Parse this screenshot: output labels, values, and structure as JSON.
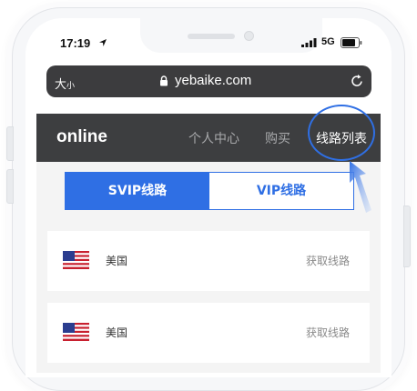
{
  "status_bar": {
    "time": "17:19",
    "network": "5G"
  },
  "browser": {
    "text_size_label": "大",
    "text_size_small": "小",
    "url": "yebaike.com"
  },
  "nav": {
    "logo": "online",
    "items": [
      {
        "label": "个人中心"
      },
      {
        "label": "购买"
      },
      {
        "label": "线路列表"
      }
    ]
  },
  "tabs": [
    {
      "label": "SVIP线路",
      "active": true
    },
    {
      "label": "VIP线路",
      "active": false
    }
  ],
  "routes": [
    {
      "country": "美国",
      "action": "获取线路"
    },
    {
      "country": "美国",
      "action": "获取线路"
    }
  ],
  "colors": {
    "accent": "#2f6fe4",
    "nav_bg": "#3d3e40",
    "url_bar_bg": "#3c3c3e"
  }
}
